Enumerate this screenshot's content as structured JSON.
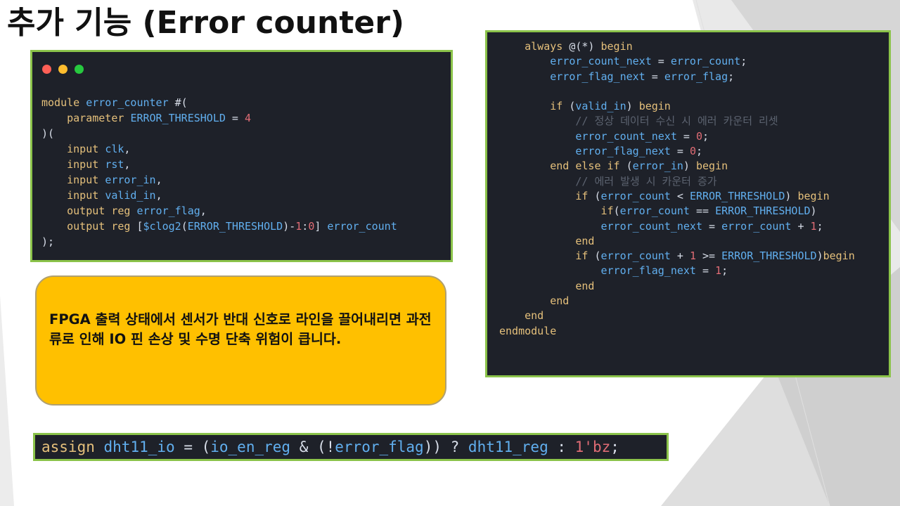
{
  "slide": {
    "title": "추가 기능 (Error counter)"
  },
  "module_code": {
    "window_dots": [
      "#ff5f56",
      "#ffbd2e",
      "#27c93f"
    ],
    "lines": [
      "module error_counter #(",
      "    parameter ERROR_THRESHOLD = 4",
      ")(",
      "    input clk,",
      "    input rst,",
      "    input error_in,",
      "    input valid_in,",
      "    output reg error_flag,",
      "    output reg [$clog2(ERROR_THRESHOLD)-1:0] error_count",
      ");"
    ]
  },
  "always_code": {
    "lines": [
      "    always @(*) begin",
      "        error_count_next = error_count;",
      "        error_flag_next = error_flag;",
      "",
      "        if (valid_in) begin",
      "            // 정상 데이터 수신 시 에러 카운터 리셋",
      "            error_count_next = 0;",
      "            error_flag_next = 0;",
      "        end else if (error_in) begin",
      "            // 에러 발생 시 카운터 증가",
      "            if (error_count < ERROR_THRESHOLD) begin",
      "                if(error_count == ERROR_THRESHOLD)",
      "                error_count_next = error_count + 1;",
      "            end",
      "            if (error_count + 1 >= ERROR_THRESHOLD)begin",
      "                error_flag_next = 1;",
      "            end",
      "        end",
      "    end",
      "endmodule"
    ]
  },
  "callout": {
    "text": "FPGA 출력 상태에서 센서가 반대 신호로 라인을 끌어내리면 과전류로 인해 IO 핀 손상 및 수명 단축 위험이 큽니다."
  },
  "assign_line": {
    "text": "assign dht11_io = (io_en_reg & (!error_flag)) ? dht11_reg : 1'bz;"
  },
  "colors": {
    "panel_border": "#8bc34a",
    "panel_bg": "#1e2129",
    "callout_bg": "#ffc000"
  }
}
